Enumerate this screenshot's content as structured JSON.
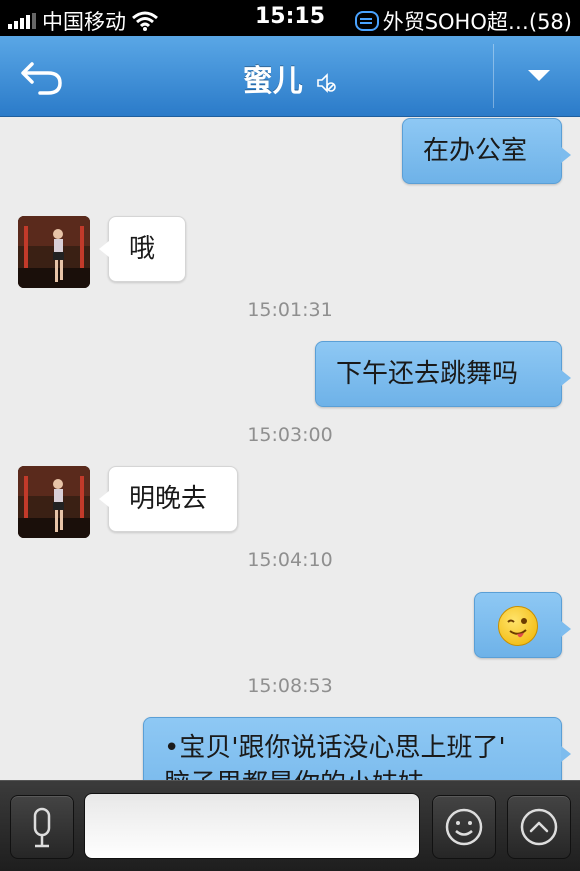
{
  "status_bar": {
    "carrier": "中国移动",
    "time": "15:15",
    "notification": "外贸SOHO超…(58)"
  },
  "nav": {
    "title": "蜜儿",
    "back_icon": "back-arrow-icon",
    "mute_icon": "muted-speaker-icon",
    "dropdown_icon": "triangle-down-icon"
  },
  "messages": [
    {
      "dir": "out",
      "text": "在办公室"
    },
    {
      "dir": "in",
      "text": "哦"
    },
    {
      "timestamp": "15:01:31"
    },
    {
      "dir": "out",
      "text": "下午还去跳舞吗"
    },
    {
      "timestamp": "15:03:00"
    },
    {
      "dir": "in",
      "text": "明晚去"
    },
    {
      "timestamp": "15:04:10"
    },
    {
      "dir": "out",
      "emoji": "wink-tongue-emoji"
    },
    {
      "timestamp": "15:08:53"
    },
    {
      "dir": "out",
      "line1": "•宝贝'跟你说话没心思上班了'",
      "line2": "脑子里都是你的小妹妹"
    }
  ],
  "input_bar": {
    "voice_icon": "microphone-icon",
    "emoji_icon": "smiley-icon",
    "more_icon": "chevron-up-circle-icon",
    "input_value": ""
  },
  "colors": {
    "nav_blue": "#3a8ad6",
    "outgoing_bubble": "#7dbcee",
    "incoming_bubble": "#ffffff",
    "background": "#ececec"
  }
}
